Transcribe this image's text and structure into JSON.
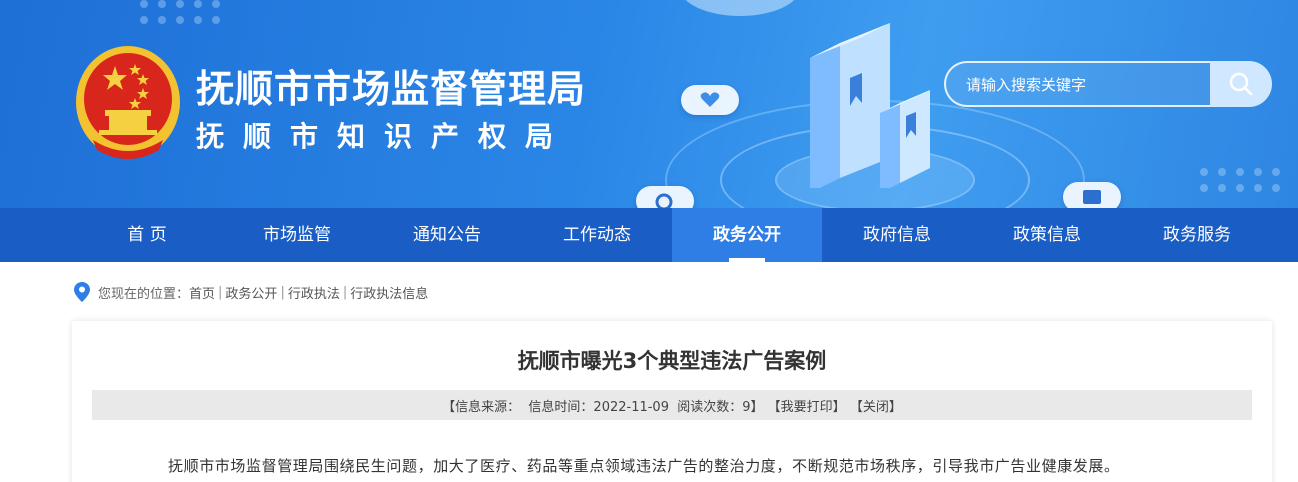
{
  "site": {
    "title_primary": "抚顺市市场监督管理局",
    "title_secondary": "抚顺市知识产权局"
  },
  "search": {
    "placeholder": "请输入搜索关键字"
  },
  "nav": {
    "items": [
      {
        "label": "首 页"
      },
      {
        "label": "市场监管"
      },
      {
        "label": "通知公告"
      },
      {
        "label": "工作动态"
      },
      {
        "label": "政务公开"
      },
      {
        "label": "政府信息"
      },
      {
        "label": "政策信息"
      },
      {
        "label": "政务服务"
      }
    ],
    "active_index": 4
  },
  "breadcrumb": {
    "prefix": "您现在的位置：",
    "items": [
      "首页",
      "政务公开",
      "行政执法",
      "行政执法信息"
    ],
    "separator": "|"
  },
  "article": {
    "title": "抚顺市曝光3个典型违法广告案例",
    "meta": {
      "source": "【信息来源：  信息时间：2022-11-09  阅读次数：9】",
      "print": "【我要打印】",
      "close": "【关闭】"
    },
    "body_first_line": "抚顺市市场监督管理局围绕民生问题，加大了医疗、药品等重点领域违法广告的整治力度，不断规范市场秩序，引导我市广告业健康发展。"
  },
  "colors": {
    "banner": "#2a86e6",
    "nav_bg": "#1a5dc4",
    "nav_active": "#2f7ee6",
    "pin": "#2f7ee6"
  }
}
